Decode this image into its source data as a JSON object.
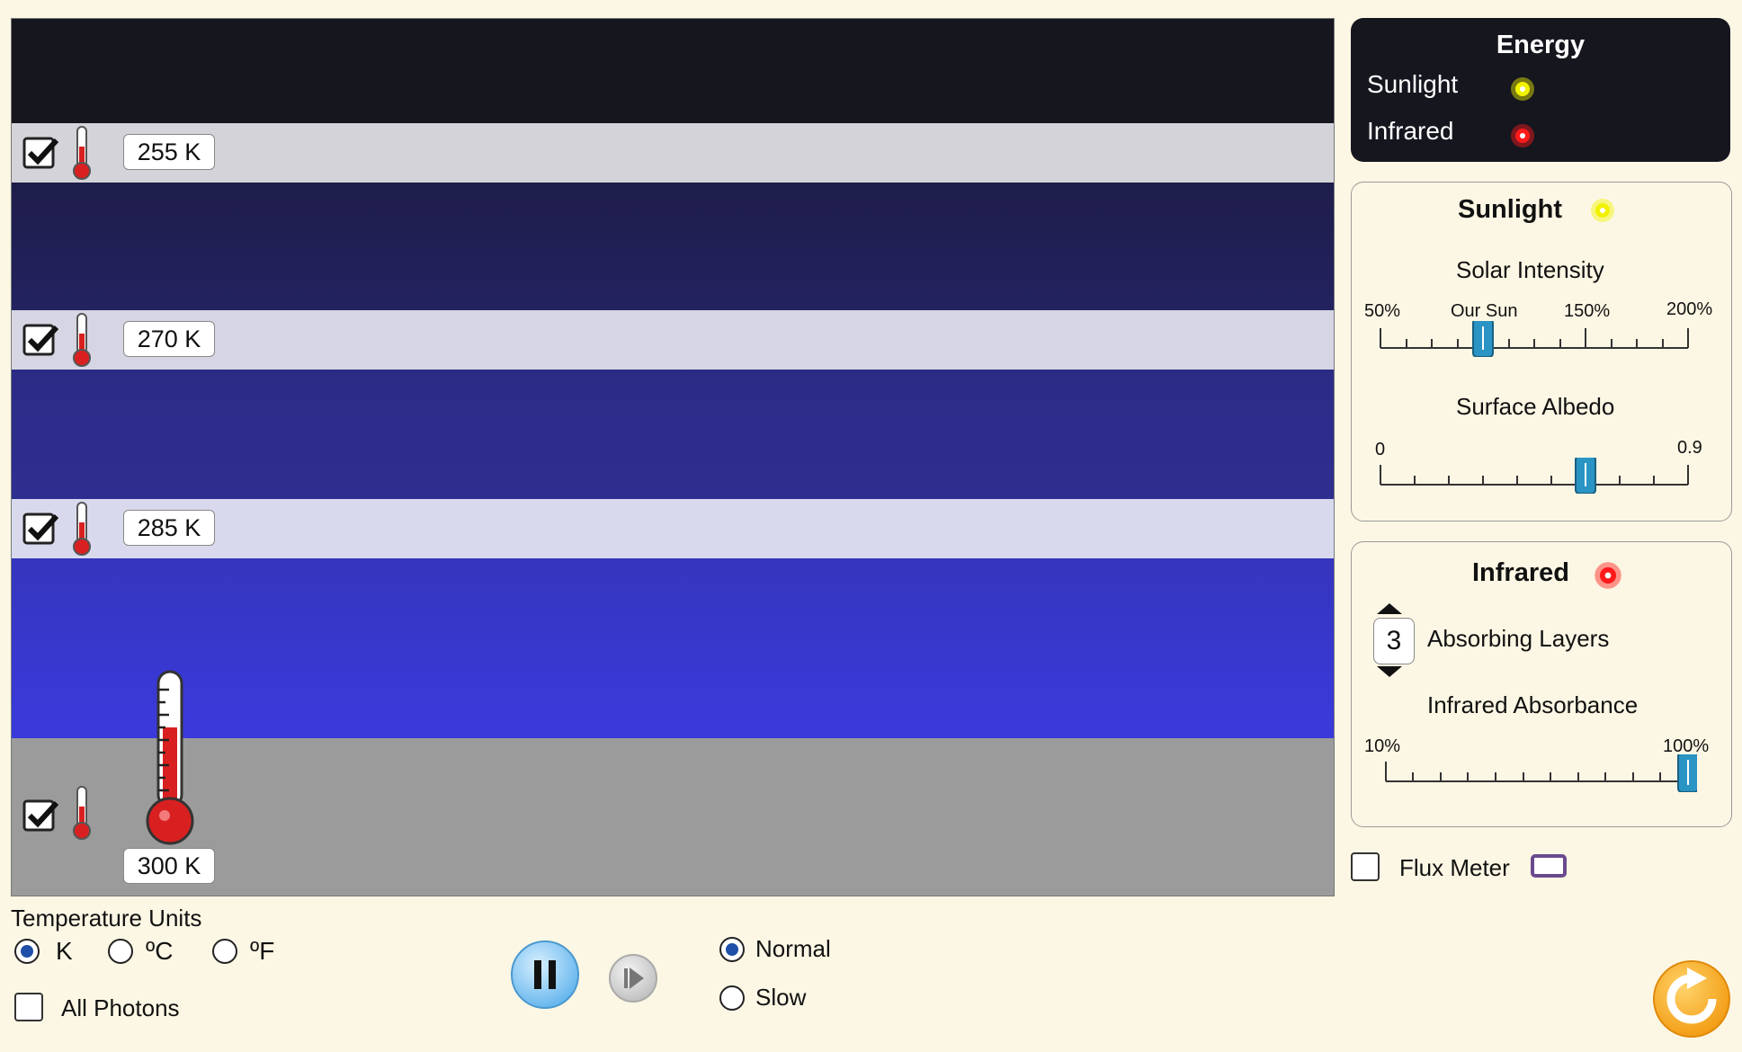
{
  "layers": [
    {
      "temp": "255 K",
      "checked": true
    },
    {
      "temp": "270 K",
      "checked": true
    },
    {
      "temp": "285 K",
      "checked": true
    }
  ],
  "surface": {
    "temp": "300 K",
    "checked": true,
    "level": 0.6
  },
  "legend": {
    "title": "Energy",
    "sunlight": "Sunlight",
    "infrared": "Infrared"
  },
  "sunlight_panel": {
    "title": "Sunlight",
    "solar": {
      "label": "Solar Intensity",
      "min": "50%",
      "mid": "Our Sun",
      "high": "150%",
      "max": "200%",
      "value_pct": 100
    },
    "albedo": {
      "label": "Surface Albedo",
      "min": "0",
      "max": "0.9",
      "value": 0.6
    }
  },
  "infrared_panel": {
    "title": "Infrared",
    "layers_value": "3",
    "layers_label": "Absorbing Layers",
    "absorbance": {
      "label": "Infrared Absorbance",
      "min": "10%",
      "max": "100%",
      "value_pct": 100
    }
  },
  "flux": {
    "label": "Flux Meter",
    "checked": false
  },
  "units": {
    "title": "Temperature Units",
    "k": "K",
    "c": "ºC",
    "f": "ºF",
    "selected": "K"
  },
  "photons": {
    "label": "All Photons",
    "checked": false
  },
  "speed": {
    "normal": "Normal",
    "slow": "Slow",
    "selected": "Normal"
  },
  "colors": {
    "sunlight": "#f2f200",
    "infrared": "#ff1a1a",
    "slider": "#2a94c4"
  }
}
